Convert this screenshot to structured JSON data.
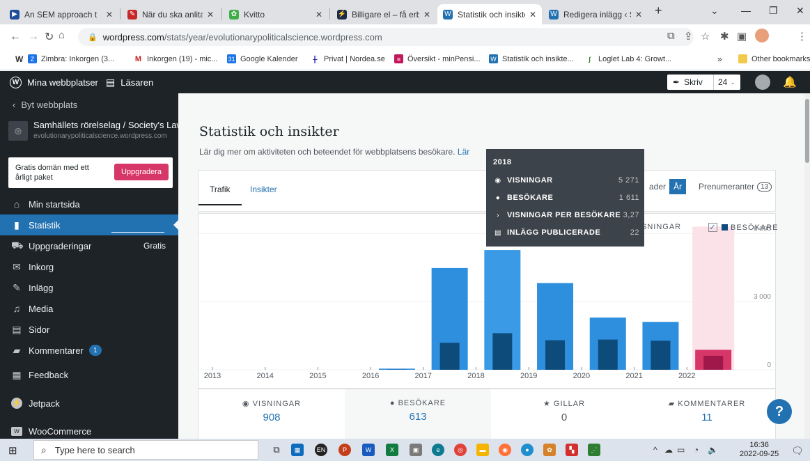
{
  "browser": {
    "tabs": [
      {
        "title": "An SEM approach t",
        "color": "#1f4e9a",
        "glyph": "▶"
      },
      {
        "title": "När du ska anlita e",
        "color": "#c62828",
        "glyph": "✎"
      },
      {
        "title": "Kvitto",
        "color": "#3fae49",
        "glyph": "✿"
      },
      {
        "title": "Billigare el – få erbj",
        "color": "#1b2a4a",
        "glyph": "⚡"
      },
      {
        "title": "Statistik och insikte",
        "color": "#2271b1",
        "glyph": "W"
      },
      {
        "title": "Redigera inlägg ‹ S",
        "color": "#2271b1",
        "glyph": "W"
      }
    ],
    "new_tab": "+",
    "url_host": "wordpress.com",
    "url_path": "/stats/year/evolutionarypoliticalscience.wordpress.com",
    "bookmarks": [
      {
        "label": "Zimbra: Inkorgen (3...",
        "color": "#1a73e8",
        "glyph": "Z"
      },
      {
        "label": "Inkorgen (19) - mic...",
        "color": "#c5221f",
        "glyph": "M"
      },
      {
        "label": "Google Kalender",
        "color": "#1a73e8",
        "glyph": "31"
      },
      {
        "label": "Privat | Nordea.se",
        "color": "#0000a0",
        "glyph": "N"
      },
      {
        "label": "Översikt - minPensi...",
        "color": "#c2185b",
        "glyph": "≡"
      },
      {
        "label": "Statistik och insikte...",
        "color": "#2271b1",
        "glyph": "W"
      },
      {
        "label": "Loglet Lab 4: Growt...",
        "color": "#2e7d32",
        "glyph": "∫"
      }
    ],
    "bookmarks_more": "»",
    "other_bookmarks": "Other bookmarks"
  },
  "wpbar": {
    "my_sites": "Mina webbplatser",
    "reader": "Läsaren",
    "write": "Skriv",
    "write_count": "24"
  },
  "sidebar": {
    "back": "Byt webbplats",
    "site_name": "Samhällets rörelselag / Society's Law",
    "site_url": "evolutionarypoliticalscience.wordpress.com",
    "promo_text": "Gratis domän med ett årligt paket",
    "promo_button": "Uppgradera",
    "items": [
      {
        "label": "Min startsida",
        "icon": "⌂",
        "name": "sidebar-item-min-startsida"
      },
      {
        "label": "Statistik",
        "icon": "▮",
        "name": "sidebar-item-statistik"
      },
      {
        "label": "Uppgraderingar",
        "icon": "🛒",
        "name": "sidebar-item-uppgraderingar",
        "right": "Gratis"
      },
      {
        "label": "Inkorg",
        "icon": "✉",
        "name": "sidebar-item-inkorg"
      },
      {
        "label": "Inlägg",
        "icon": "📌",
        "name": "sidebar-item-inlagg"
      },
      {
        "label": "Media",
        "icon": "♫",
        "name": "sidebar-item-media"
      },
      {
        "label": "Sidor",
        "icon": "▤",
        "name": "sidebar-item-sidor"
      },
      {
        "label": "Kommentarer",
        "icon": "💬",
        "name": "sidebar-item-kommentarer",
        "badge": "1"
      },
      {
        "label": "Feedback",
        "icon": "▦",
        "name": "sidebar-item-feedback"
      },
      {
        "label": "Jetpack",
        "icon": "⚡",
        "name": "sidebar-item-jetpack"
      },
      {
        "label": "WooCommerce",
        "icon": "W",
        "name": "sidebar-item-woocommerce"
      }
    ]
  },
  "main": {
    "title": "Statistik och insikter",
    "subtitle": "Lär dig mer om aktiviteten och beteendet för webbplatsens besökare.",
    "subtitle_link": "Lär",
    "tabs": [
      "Trafik",
      "Insikter"
    ],
    "period_prev": "ader",
    "period_active": "År",
    "subscribers_label": "Prenumeranter",
    "subscribers_count": "13"
  },
  "legend": {
    "views": "SNINGAR",
    "visitors": "BESÖKARE"
  },
  "tooltip": {
    "year": "2018",
    "rows": [
      {
        "icon": "👁",
        "label": "VISNINGAR",
        "value": "5 271"
      },
      {
        "icon": "👤",
        "label": "BESÖKARE",
        "value": "1 611"
      },
      {
        "icon": "›",
        "label": "VISNINGAR PER BESÖKARE",
        "value": "3,27"
      },
      {
        "icon": "▤",
        "label": "INLÄGG PUBLICERADE",
        "value": "22"
      }
    ]
  },
  "chart_data": {
    "type": "bar",
    "categories": [
      "2013",
      "2014",
      "2015",
      "2016",
      "2017",
      "2018",
      "2019",
      "2020",
      "2021",
      "2022"
    ],
    "series": [
      {
        "name": "VISNINGAR",
        "values": [
          0,
          0,
          0,
          50,
          4480,
          5271,
          3820,
          2300,
          2110,
          0
        ]
      },
      {
        "name": "BESÖKARE",
        "values": [
          0,
          0,
          0,
          10,
          1190,
          1611,
          1300,
          1330,
          1280,
          880
        ]
      }
    ],
    "y_ticks": [
      "6 000",
      "3 000",
      "0"
    ],
    "ylim": [
      0,
      6500
    ],
    "highlight_index": 5,
    "current_index": 9,
    "colors": {
      "views": "#2e8fdf",
      "views_hover": "#3a9ae6",
      "visitors": "#0d4b7a",
      "current_bg": "#fbe1e8",
      "current_visitors": "#d63668",
      "current_views_inner": "#a0174a"
    }
  },
  "summary": [
    {
      "icon": "👁",
      "label": "VISNINGAR",
      "value": "908"
    },
    {
      "icon": "👤",
      "label": "BESÖKARE",
      "value": "613"
    },
    {
      "icon": "★",
      "label": "GILLAR",
      "value": "0"
    },
    {
      "icon": "💬",
      "label": "KOMMENTARER",
      "value": "11"
    }
  ],
  "help": "?",
  "taskbar": {
    "search_placeholder": "Type here to search",
    "time": "16:36",
    "date": "2022-09-25",
    "lang": "EN"
  }
}
